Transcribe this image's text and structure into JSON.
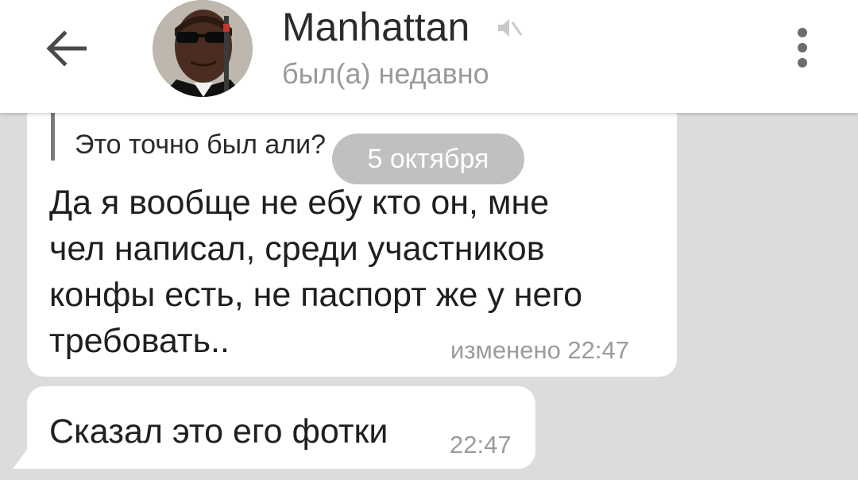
{
  "header": {
    "contact_name": "Manhattan",
    "status": "был(а) недавно",
    "back_icon": "arrow-left-icon",
    "mute_icon": "muted-speaker-icon",
    "menu_icon": "more-vertical-icon"
  },
  "messages": [
    {
      "reply_quote": "Это точно был али?",
      "lines": [
        "Да я вообще не ебу кто он, мне",
        "чел написал, среди участников",
        "конфы есть, не паспорт же у него",
        "требовать.."
      ],
      "meta": "изменено 22:47"
    },
    {
      "text": "Сказал это его фотки",
      "time": "22:47"
    }
  ],
  "date_chip": "5 октября",
  "colors": {
    "header_bg": "#ffffff",
    "chat_bg": "#dcdcdc",
    "bubble_bg": "#ffffff",
    "meta_text": "#9b9b9b"
  }
}
